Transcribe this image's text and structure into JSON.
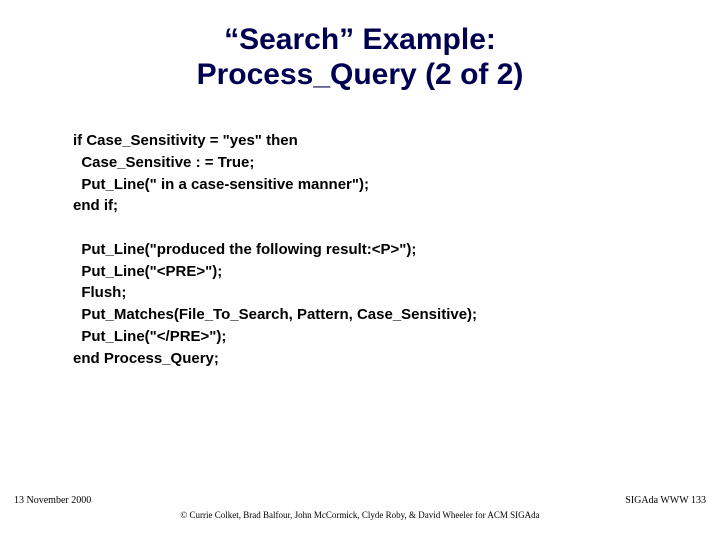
{
  "title_line1": "“Search” Example:",
  "title_line2": "Process_Query (2 of 2)",
  "code": {
    "l1": "if Case_Sensitivity = \"yes\" then",
    "l2": "  Case_Sensitive : = True;",
    "l3": "  Put_Line(\" in a case-sensitive manner\");",
    "l4": "end if;",
    "l5": "",
    "l6": "  Put_Line(\"produced the following result:<P>\");",
    "l7": "  Put_Line(\"<PRE>\");",
    "l8": "  Flush;",
    "l9": "  Put_Matches(File_To_Search, Pattern, Case_Sensitive);",
    "l10": "  Put_Line(\"</PRE>\");",
    "l11": "end Process_Query;"
  },
  "footer": {
    "date": "13 November 2000",
    "page": "SIGAda WWW 133",
    "copyright": "© Currie Colket, Brad Balfour, John McCormick, Clyde Roby, & David Wheeler for ACM SIGAda"
  }
}
